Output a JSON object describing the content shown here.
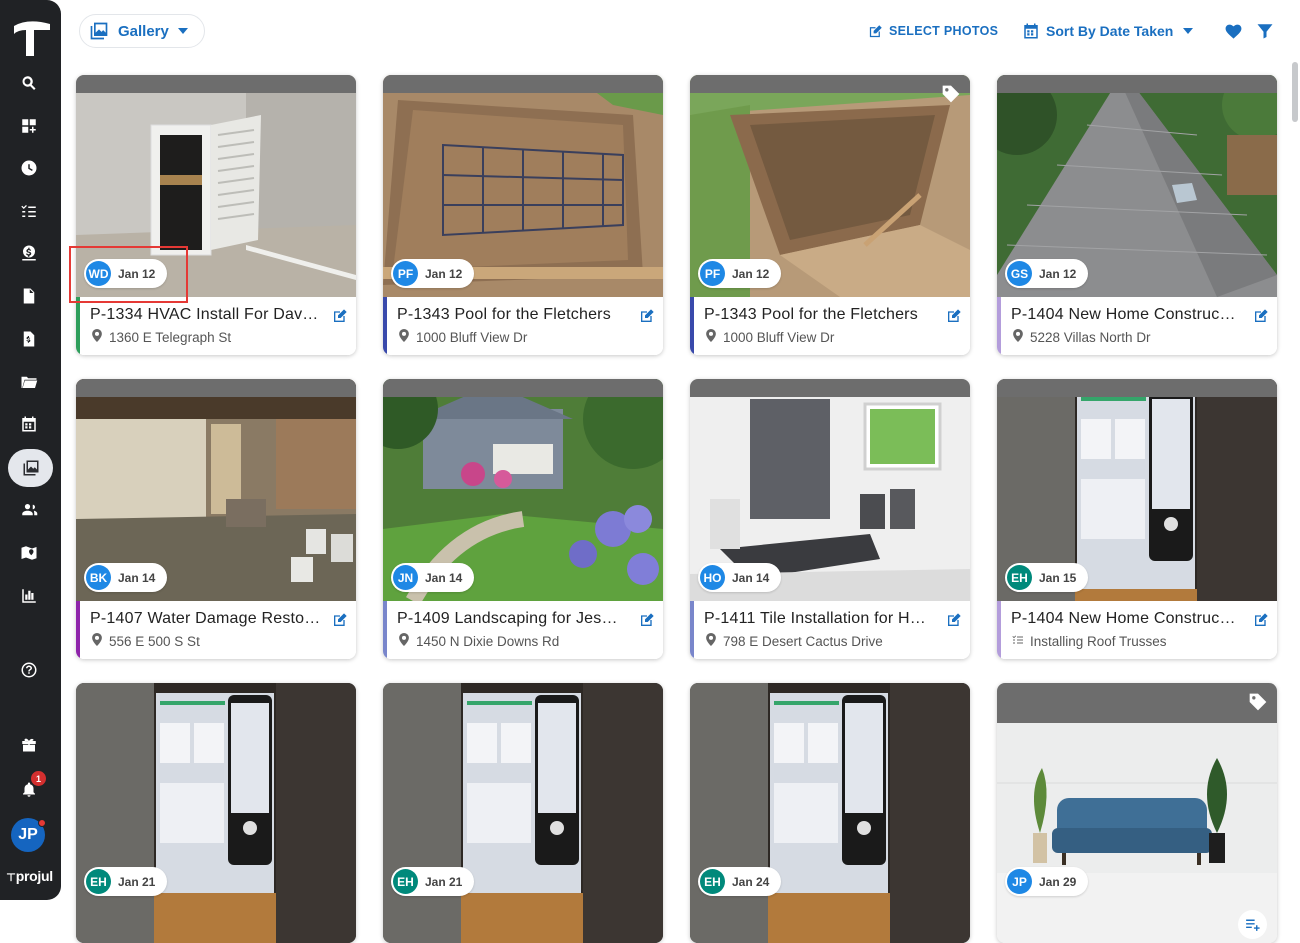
{
  "nav": {
    "items": [
      {
        "name": "search-icon",
        "label": "Search"
      },
      {
        "name": "dashboard-icon",
        "label": "Dashboard"
      },
      {
        "name": "clock-icon",
        "label": "Time"
      },
      {
        "name": "checklist-icon",
        "label": "Tasks"
      },
      {
        "name": "money-icon",
        "label": "Financials"
      },
      {
        "name": "document-icon",
        "label": "Documents"
      },
      {
        "name": "invoice-icon",
        "label": "Invoices"
      },
      {
        "name": "folder-icon",
        "label": "Files"
      },
      {
        "name": "calendar-icon",
        "label": "Calendar"
      },
      {
        "name": "photos-icon",
        "label": "Photos",
        "active": true
      },
      {
        "name": "people-icon",
        "label": "Contacts"
      },
      {
        "name": "map-icon",
        "label": "Map"
      },
      {
        "name": "reports-icon",
        "label": "Reports"
      }
    ],
    "notification_count": "1",
    "user_initials": "JP",
    "brand": "projul"
  },
  "toolbar": {
    "view_label": "Gallery",
    "select_photos_label": "SELECT PHOTOS",
    "sort_label": "Sort By Date Taken"
  },
  "colors": {
    "accent": "#1a6fc0",
    "sidebar": "#202225",
    "highlight": "#e53935"
  },
  "cards": [
    {
      "initials": "WD",
      "avatar_color": "#1e88e5",
      "date": "Jan 12",
      "title": "P-1334 HVAC Install For Dav…",
      "subtitle": "1360 E Telegraph St",
      "sub_icon": "pin-icon",
      "stripe": "#2e9e5b",
      "photo": "hvac"
    },
    {
      "initials": "PF",
      "avatar_color": "#1e88e5",
      "date": "Jan 12",
      "title": "P-1343 Pool for the Fletchers",
      "subtitle": "1000 Bluff View Dr",
      "sub_icon": "pin-icon",
      "stripe": "#3949ab",
      "photo": "pool1"
    },
    {
      "initials": "PF",
      "avatar_color": "#1e88e5",
      "date": "Jan 12",
      "title": "P-1343 Pool for the Fletchers",
      "subtitle": "1000 Bluff View Dr",
      "sub_icon": "pin-icon",
      "stripe": "#3949ab",
      "photo": "pool2",
      "tag": true
    },
    {
      "initials": "GS",
      "avatar_color": "#1e88e5",
      "date": "Jan 12",
      "title": "P-1404 New Home Construc…",
      "subtitle": "5228 Villas North Dr",
      "sub_icon": "pin-icon",
      "stripe": "#b39ddb",
      "photo": "roof"
    },
    {
      "initials": "BK",
      "avatar_color": "#1e88e5",
      "date": "Jan 14",
      "title": "P-1407 Water Damage Resto…",
      "subtitle": "556 E 500 S St",
      "sub_icon": "pin-icon",
      "stripe": "#8e24aa",
      "photo": "water"
    },
    {
      "initials": "JN",
      "avatar_color": "#1e88e5",
      "date": "Jan 14",
      "title": "P-1409 Landscaping for Jes…",
      "subtitle": "1450 N Dixie Downs Rd",
      "sub_icon": "pin-icon",
      "stripe": "#7986cb",
      "photo": "garden"
    },
    {
      "initials": "HO",
      "avatar_color": "#1e88e5",
      "date": "Jan 14",
      "title": "P-1411 Tile Installation for H…",
      "subtitle": "798 E Desert Cactus Drive",
      "sub_icon": "pin-icon",
      "stripe": "#7986cb",
      "photo": "tile"
    },
    {
      "initials": "EH",
      "avatar_color": "#00897b",
      "date": "Jan 15",
      "title": "P-1404 New Home Construc…",
      "subtitle": "Installing Roof Trusses",
      "sub_icon": "checklist-icon",
      "stripe": "#b39ddb",
      "photo": "screen"
    },
    {
      "initials": "EH",
      "avatar_color": "#00897b",
      "date": "Jan 21",
      "photo": "screen"
    },
    {
      "initials": "EH",
      "avatar_color": "#00897b",
      "date": "Jan 21",
      "photo": "screen"
    },
    {
      "initials": "EH",
      "avatar_color": "#00897b",
      "date": "Jan 24",
      "photo": "screen"
    },
    {
      "initials": "JP",
      "avatar_color": "#1e88e5",
      "date": "Jan 29",
      "photo": "sofa",
      "tag": true,
      "playlist": true
    }
  ]
}
